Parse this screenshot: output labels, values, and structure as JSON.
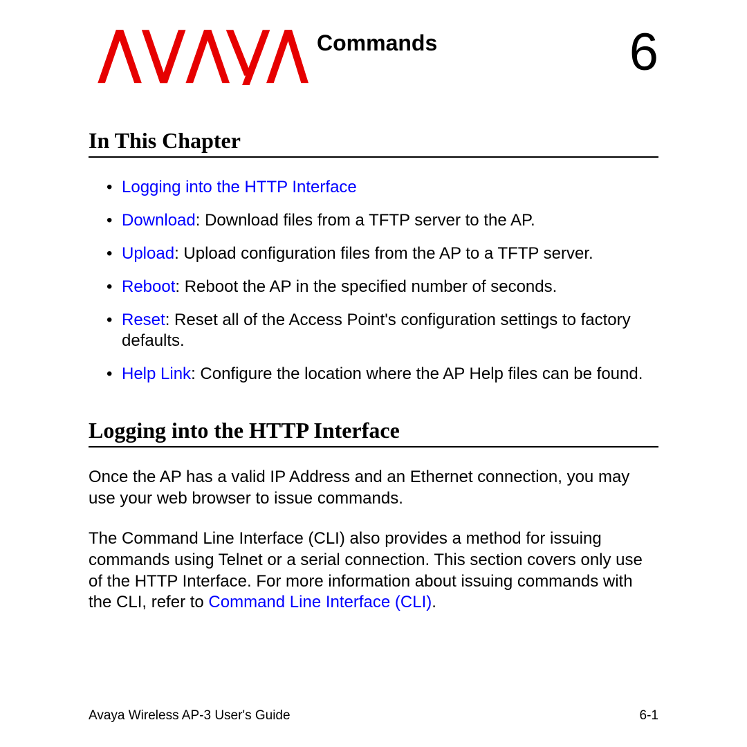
{
  "header": {
    "title": "Commands",
    "chapter_number": "6"
  },
  "sections": {
    "in_this_chapter": {
      "heading": "In This Chapter",
      "items": [
        {
          "link": "Logging into the HTTP Interface",
          "text_after": ""
        },
        {
          "link": "Download",
          "text_after": ": Download files from a TFTP server to the AP."
        },
        {
          "link": "Upload",
          "text_after": ": Upload configuration files from the AP to a TFTP server."
        },
        {
          "link": "Reboot",
          "text_after": ": Reboot the AP in the specified number of seconds."
        },
        {
          "link": "Reset",
          "text_after": ": Reset all of the Access Point's configuration settings to factory defaults."
        },
        {
          "link": "Help Link",
          "text_after": ": Configure the location where the AP Help files can be found."
        }
      ]
    },
    "logging": {
      "heading": "Logging into the HTTP Interface",
      "para1": "Once the AP has a valid IP Address and an Ethernet connection, you may use your web browser to issue commands.",
      "para2_before": "The Command Line Interface (CLI) also provides a method for issuing commands using Telnet or a serial connection. This section covers only use of the HTTP Interface. For more information about issuing commands with the CLI, refer to ",
      "para2_link": "Command Line Interface (CLI)",
      "para2_after": "."
    }
  },
  "footer": {
    "left": "Avaya Wireless AP-3 User's Guide",
    "right": "6-1"
  },
  "brand": {
    "name": "AVAYA",
    "color": "#e60000"
  }
}
